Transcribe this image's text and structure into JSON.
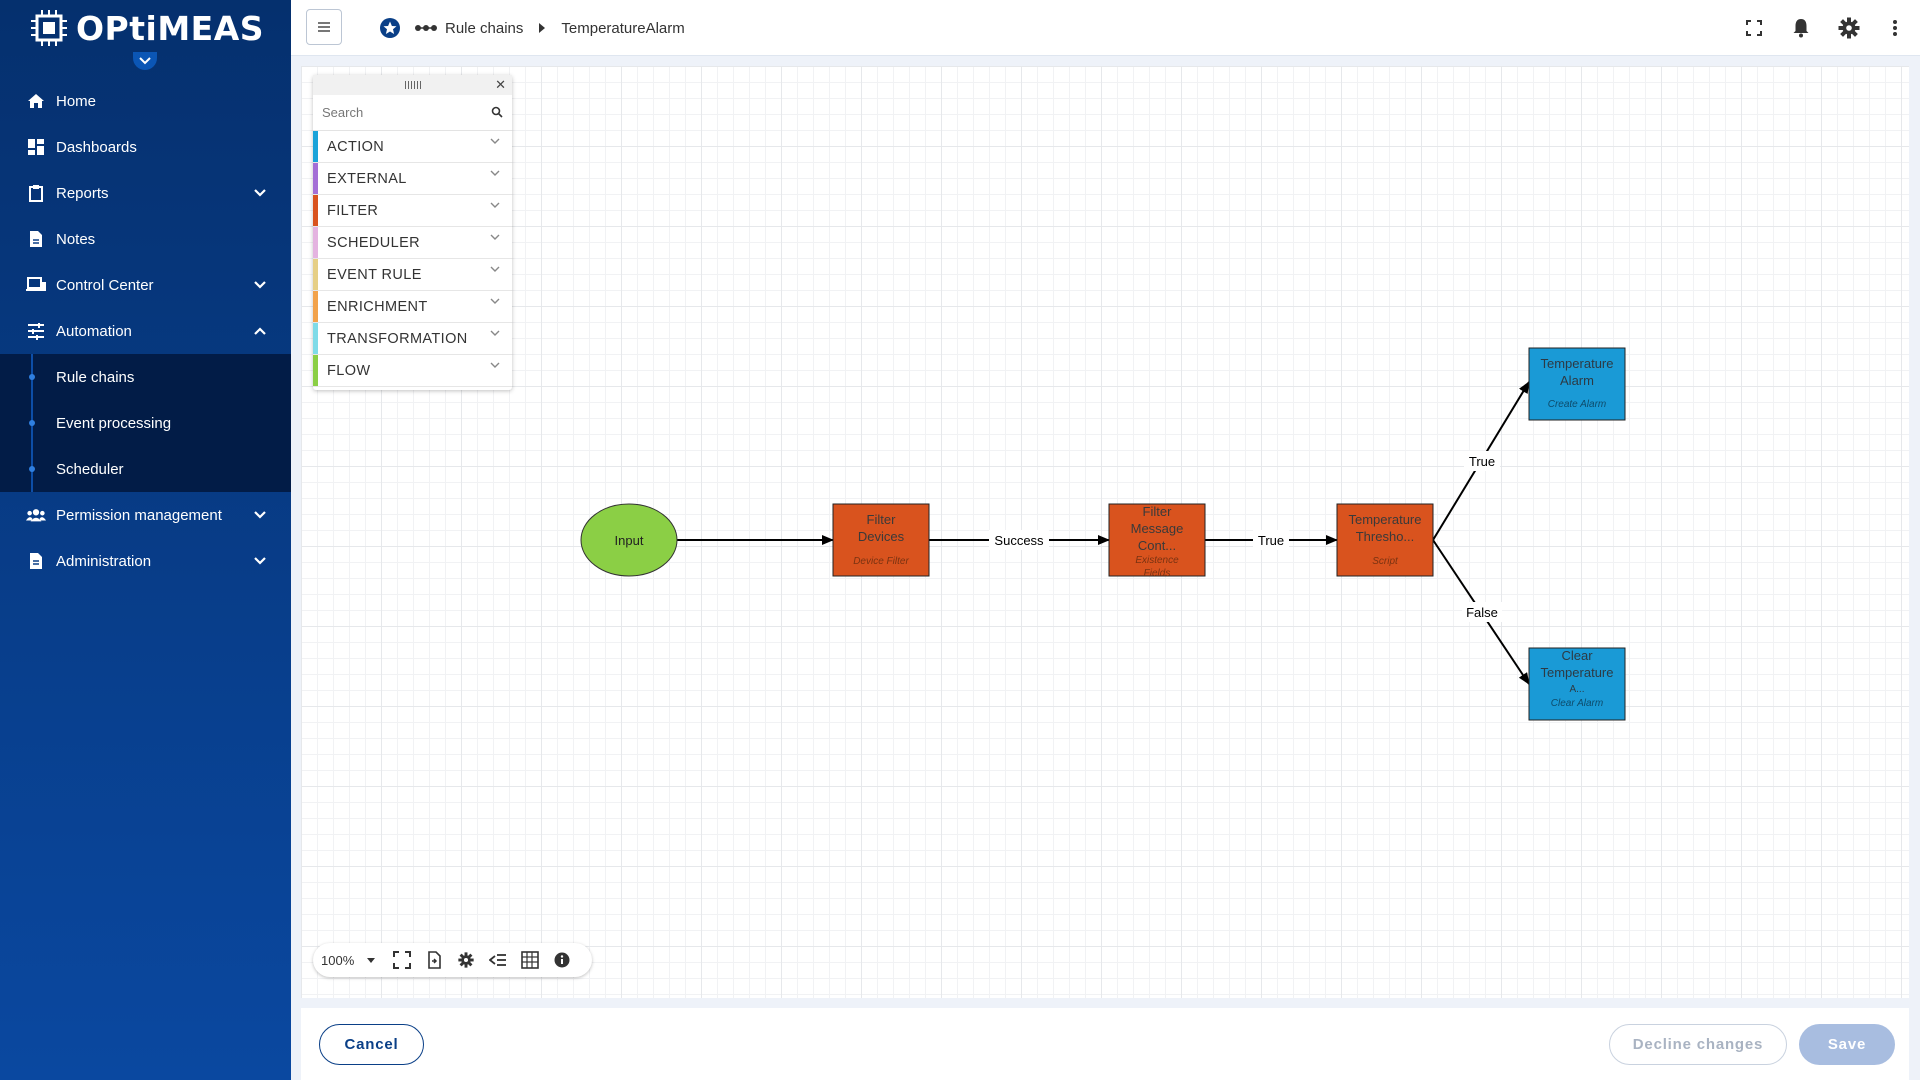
{
  "app": {
    "logo_text": "OPtiMEAS"
  },
  "sidebar": {
    "items": [
      {
        "label": "Home",
        "icon": "home-icon"
      },
      {
        "label": "Dashboards",
        "icon": "dashboard-icon"
      },
      {
        "label": "Reports",
        "icon": "clipboard-icon",
        "expandable": true
      },
      {
        "label": "Notes",
        "icon": "note-icon"
      },
      {
        "label": "Control Center",
        "icon": "devices-icon",
        "expandable": true
      },
      {
        "label": "Automation",
        "icon": "tune-icon",
        "expanded": true
      },
      {
        "label": "Permission management",
        "icon": "people-icon",
        "expandable": true
      },
      {
        "label": "Administration",
        "icon": "document-icon",
        "expandable": true
      }
    ],
    "automation_sub": [
      {
        "label": "Rule chains"
      },
      {
        "label": "Event processing"
      },
      {
        "label": "Scheduler"
      }
    ]
  },
  "header": {
    "breadcrumb": [
      {
        "label": "Rule chains"
      },
      {
        "label": "TemperatureAlarm"
      }
    ]
  },
  "palette": {
    "search_placeholder": "Search",
    "categories": [
      {
        "label": "ACTION",
        "color": "#1aa3d9"
      },
      {
        "label": "EXTERNAL",
        "color": "#a46fd6"
      },
      {
        "label": "FILTER",
        "color": "#d9531e"
      },
      {
        "label": "SCHEDULER",
        "color": "#e4b3e0"
      },
      {
        "label": "EVENT RULE",
        "color": "#e6cf86"
      },
      {
        "label": "ENRICHMENT",
        "color": "#f2a24a"
      },
      {
        "label": "TRANSFORMATION",
        "color": "#7fdbe8"
      },
      {
        "label": "FLOW",
        "color": "#8bcf45"
      }
    ]
  },
  "diagram": {
    "input_label": "Input",
    "nodes": [
      {
        "id": "filter-devices",
        "title_lines": [
          "Filter",
          "Devices"
        ],
        "subtitle": "Device Filter",
        "color": "#d9531e"
      },
      {
        "id": "filter-message",
        "title_lines": [
          "Filter",
          "Message",
          "Cont..."
        ],
        "subtitle_lines": [
          "Existence",
          "Fields"
        ],
        "color": "#d9531e"
      },
      {
        "id": "temperature-threshold",
        "title_lines": [
          "Temperature",
          "Thresho..."
        ],
        "subtitle": "Script",
        "color": "#d9531e"
      },
      {
        "id": "temperature-alarm",
        "title_lines": [
          "Temperature",
          "Alarm"
        ],
        "subtitle": "Create Alarm",
        "color": "#1a9ad6"
      },
      {
        "id": "clear-temperature",
        "title_lines": [
          "Clear",
          "Temperature",
          "A..."
        ],
        "subtitle": "Clear Alarm",
        "color": "#1a9ad6"
      }
    ],
    "edge_labels": {
      "success": "Success",
      "true1": "True",
      "true2": "True",
      "false": "False"
    },
    "input_color": "#8bcf45"
  },
  "zoom": {
    "level": "100%"
  },
  "footer": {
    "cancel_label": "Cancel",
    "decline_label": "Decline changes",
    "save_label": "Save"
  }
}
